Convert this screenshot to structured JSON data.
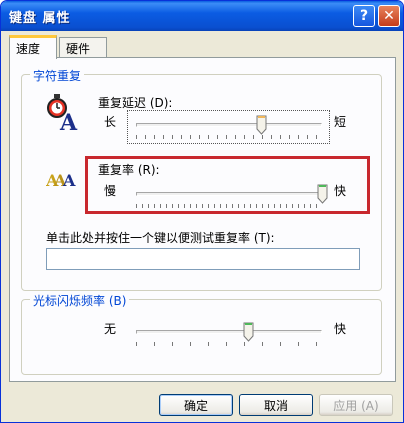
{
  "window": {
    "title": "键盘 属性",
    "help_glyph": "?",
    "close_glyph": "✕"
  },
  "tabs": [
    {
      "label": "速度",
      "active": true
    },
    {
      "label": "硬件",
      "active": false
    }
  ],
  "char_repeat": {
    "group_label": "字符重复",
    "delay": {
      "label": "重复延迟 (D):",
      "left": "长",
      "right": "短",
      "value_fraction": 0.67
    },
    "rate": {
      "label": "重复率 (R):",
      "left": "慢",
      "right": "快",
      "value_fraction": 1.0
    },
    "test_label": "单击此处并按住一个键以便测试重复率 (T):",
    "test_value": ""
  },
  "cursor_blink": {
    "group_label": "光标闪烁频率 (B)",
    "left": "无",
    "right": "快",
    "value_fraction": 0.6
  },
  "buttons": {
    "ok": "确定",
    "cancel": "取消",
    "apply": "应用 (A)"
  },
  "icons": {
    "delay_icon": "stopwatch-a-icon",
    "rate_icon": "multiple-a-icon"
  },
  "colors": {
    "titlebar": "#0a5fe0",
    "group_label": "#0046d5",
    "highlight_box": "#c8282e",
    "tab_highlight": "#ffc83c"
  }
}
